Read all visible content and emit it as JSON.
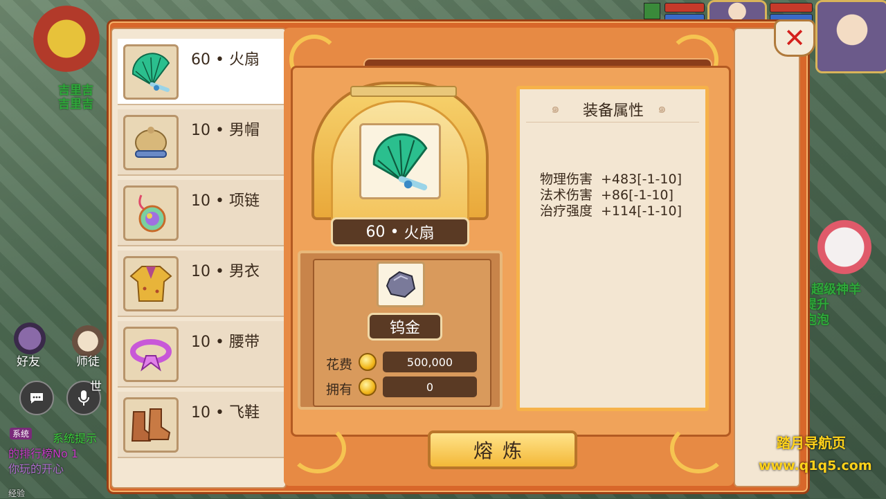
{
  "background": {
    "npc_name_top": "吉里吉",
    "npc_name_bottom": "吉里吉",
    "friend_label": "好友",
    "master_label": "师徒",
    "world_label": "世",
    "system_badge": "系统",
    "chat_line1": "系统提示",
    "chat_line2": "的排行榜No 1",
    "chat_line3": "你玩的开心",
    "chat_line4": "经验",
    "right_npc_line1": "超级神羊",
    "right_npc_line2": "提升",
    "right_npc_line3": "泡泡",
    "watermark_line1": "踏月导航页",
    "watermark_line2": "www.q1q5.com"
  },
  "equipment_list": [
    {
      "level": "60",
      "name": "火扇",
      "icon": "fan-icon",
      "selected": true
    },
    {
      "level": "10",
      "name": "男帽",
      "icon": "hat-icon",
      "selected": false
    },
    {
      "level": "10",
      "name": "项链",
      "icon": "necklace-icon",
      "selected": false
    },
    {
      "level": "10",
      "name": "男衣",
      "icon": "robe-icon",
      "selected": false
    },
    {
      "level": "10",
      "name": "腰带",
      "icon": "belt-icon",
      "selected": false
    },
    {
      "level": "10",
      "name": "飞鞋",
      "icon": "boots-icon",
      "selected": false
    }
  ],
  "selected_item": {
    "level": "60",
    "name": "火扇"
  },
  "material": {
    "name": "钨金",
    "icon": "tungsten-stone-icon"
  },
  "cost": {
    "cost_label": "花费",
    "cost_value": "500,000",
    "owned_label": "拥有",
    "owned_value": "0"
  },
  "attributes": {
    "title": "装备属性",
    "lines": [
      {
        "name": "物理伤害",
        "value": "+483[-1-10]"
      },
      {
        "name": "法术伤害",
        "value": "+86[-1-10]"
      },
      {
        "name": "治疗强度",
        "value": "+114[-1-10]"
      }
    ]
  },
  "smelt_button": "熔炼",
  "close_icon": "close-x-icon",
  "colors": {
    "frame": "#d8672a",
    "panel": "#f3e6d2",
    "dark_bar": "#5a3a24",
    "gold": "#f6c451",
    "close_red": "#d4201c",
    "watermark": "#ffd21a"
  }
}
